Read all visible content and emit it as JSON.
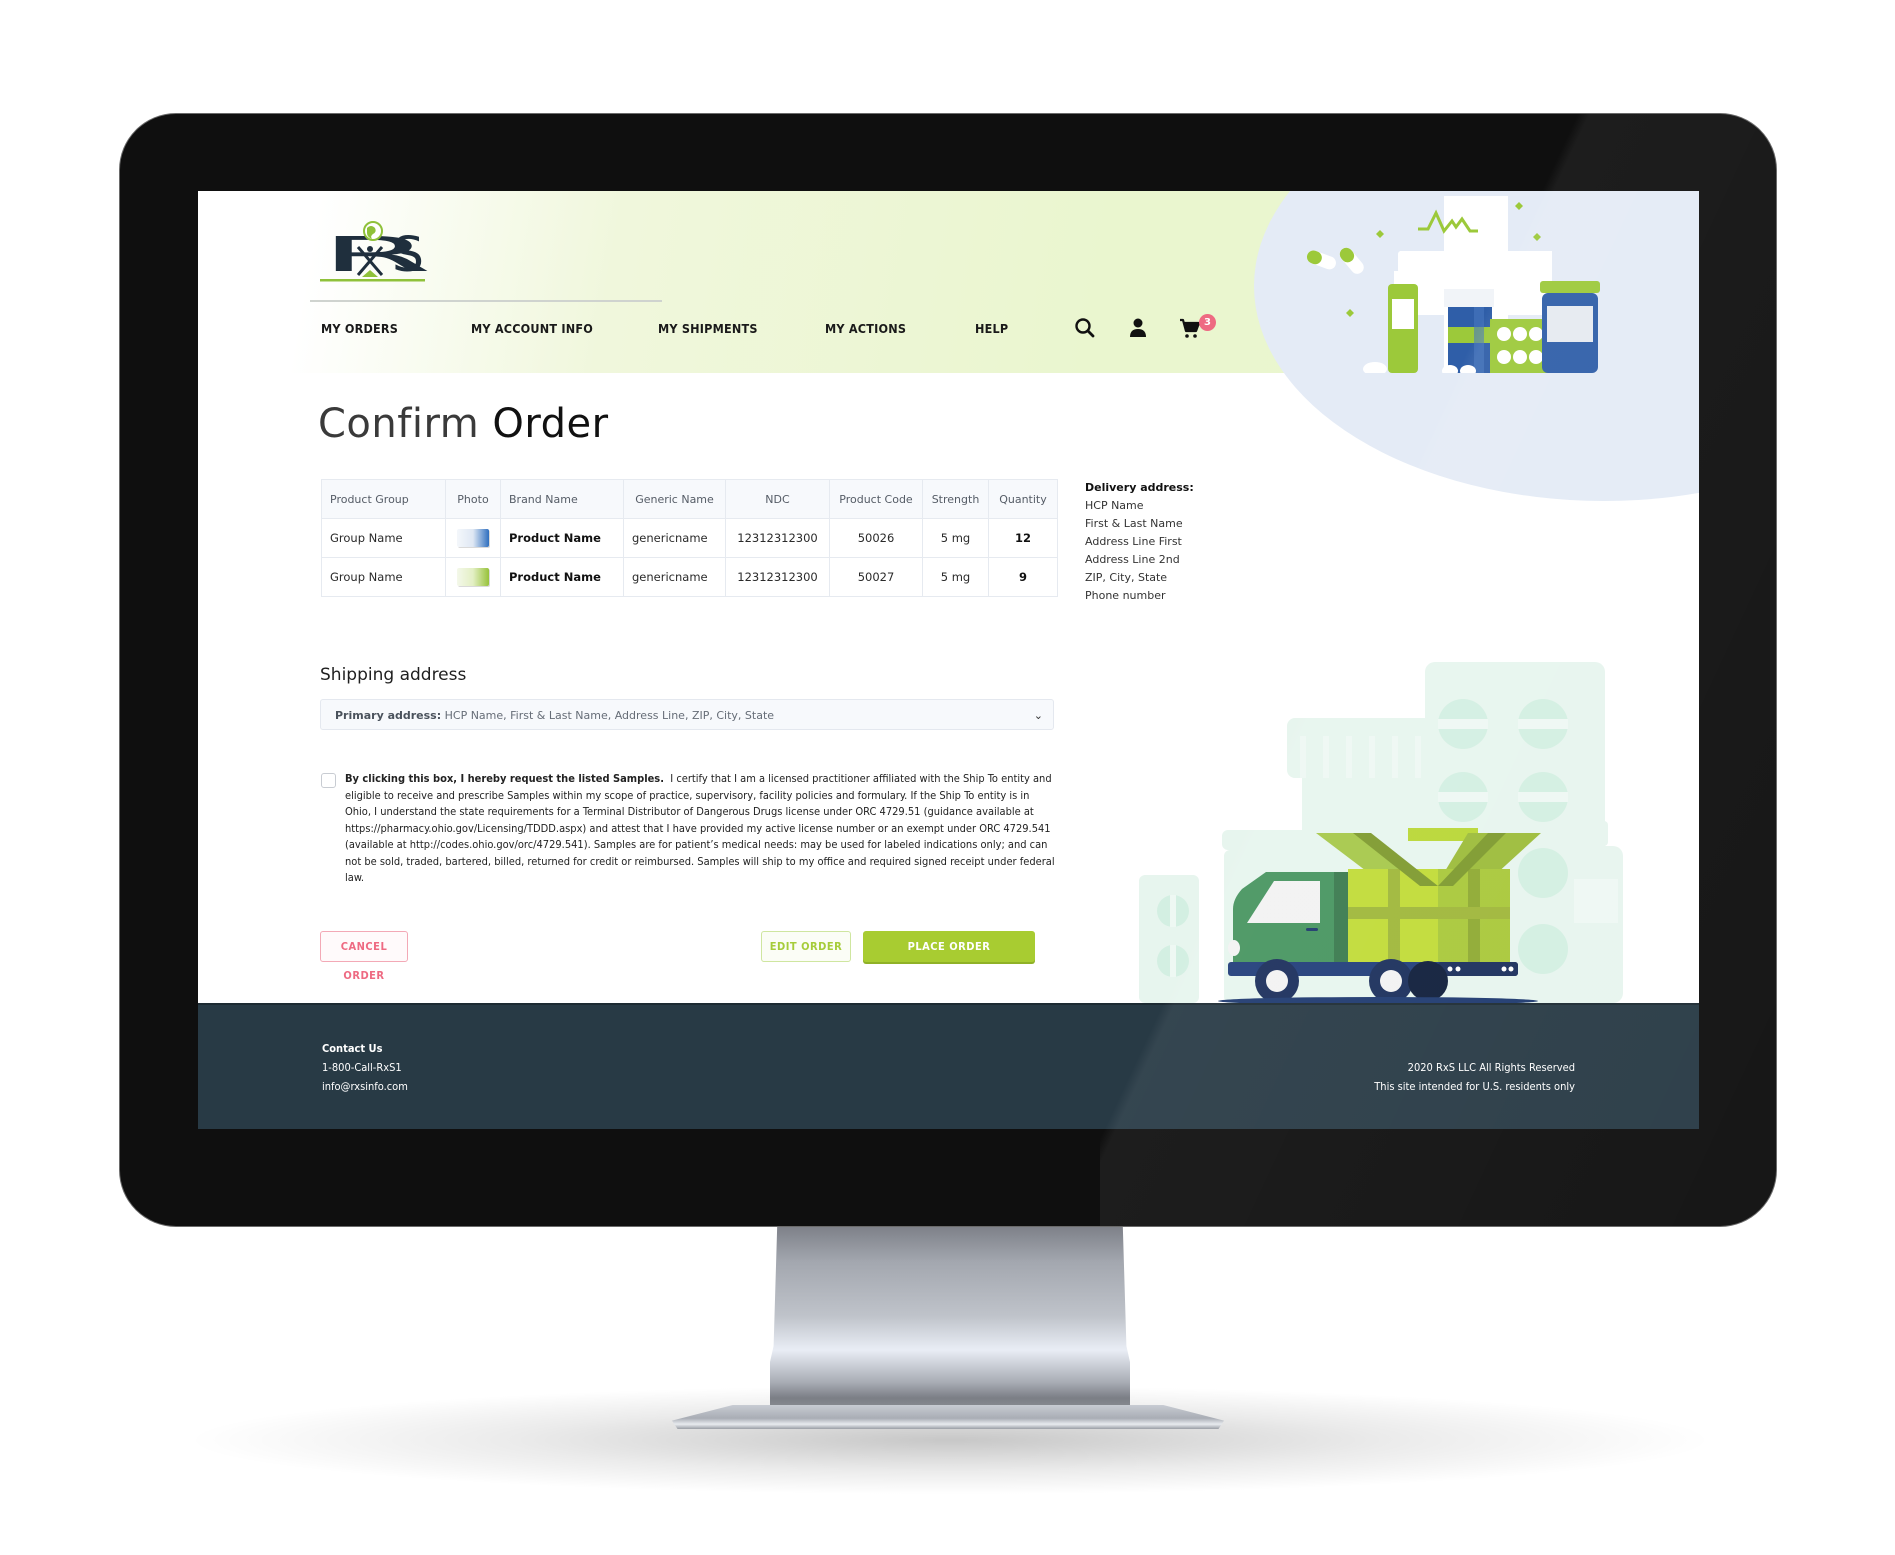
{
  "brand": {
    "logo_text": "RxS",
    "colors": {
      "accent_green": "#a8cc31",
      "cancel_pink": "#ee6a82",
      "footer_bg": "#283a45",
      "header_tint": "#eaf6cf",
      "illustration_blue": "#2f5ea8"
    }
  },
  "nav": {
    "items": [
      {
        "label": "MY ORDERS"
      },
      {
        "label": "MY ACCOUNT INFO"
      },
      {
        "label": "MY SHIPMENTS"
      },
      {
        "label": "MY ACTIONS"
      },
      {
        "label": "HELP"
      }
    ],
    "icons": {
      "search": "search-icon",
      "account": "user-icon",
      "cart": "cart-icon"
    },
    "cart_count": "3"
  },
  "page": {
    "title_light": "Confirm",
    "title_bold": "Order"
  },
  "order_table": {
    "columns": [
      "Product Group",
      "Photo",
      "Brand Name",
      "Generic Name",
      "NDC",
      "Product Code",
      "Strength",
      "Quantity"
    ],
    "rows": [
      {
        "product_group": "Group Name",
        "photo": "product-box-blue",
        "brand_name": "Product Name",
        "generic_name": "genericname",
        "ndc": "12312312300",
        "product_code": "50026",
        "strength": "5 mg",
        "quantity": "12"
      },
      {
        "product_group": "Group Name",
        "photo": "product-box-green",
        "brand_name": "Product Name",
        "generic_name": "genericname",
        "ndc": "12312312300",
        "product_code": "50027",
        "strength": "5 mg",
        "quantity": "9"
      }
    ]
  },
  "delivery": {
    "label": "Delivery address:",
    "lines": [
      "HCP Name",
      "First & Last Name",
      "Address Line First",
      "Address Line 2nd",
      "ZIP, City, State",
      "Phone number"
    ]
  },
  "shipping": {
    "title": "Shipping address",
    "select_label": "Primary address:",
    "select_value": "HCP Name, First & Last Name, Address Line, ZIP, City, State"
  },
  "terms": {
    "checked": false,
    "lead": "By clicking this box, I hereby request the listed Samples.",
    "body": "I certify that I am a licensed practitioner affiliated with the Ship To entity and eligible to receive and prescribe Samples within my scope of practice, supervisory, facility policies and formulary. If the Ship To entity is in Ohio, I understand the state requirements for a Terminal Distributor of Dangerous Drugs license under ORC 4729.51 (guidance available at https://pharmacy.ohio.gov/Licensing/TDDD.aspx) and attest that I have provided my active license number or an exempt under ORC 4729.541 (available at http://codes.ohio.gov/orc/4729.541). Samples are for patient’s medical needs: may be used for labeled indications only; and can not be sold, traded, bartered, billed, returned for credit or reimbursed. Samples will ship to my office and required signed receipt under federal law."
  },
  "actions": {
    "cancel": "CANCEL ORDER",
    "edit": "EDIT ORDER",
    "place": "PLACE ORDER"
  },
  "footer": {
    "contact_heading": "Contact Us",
    "phone": "1-800-Call-RxS1",
    "email": "info@rxsinfo.com",
    "copyright": "2020 RxS LLC All Rights Reserved",
    "notice": "This site intended for U.S. residents only"
  }
}
